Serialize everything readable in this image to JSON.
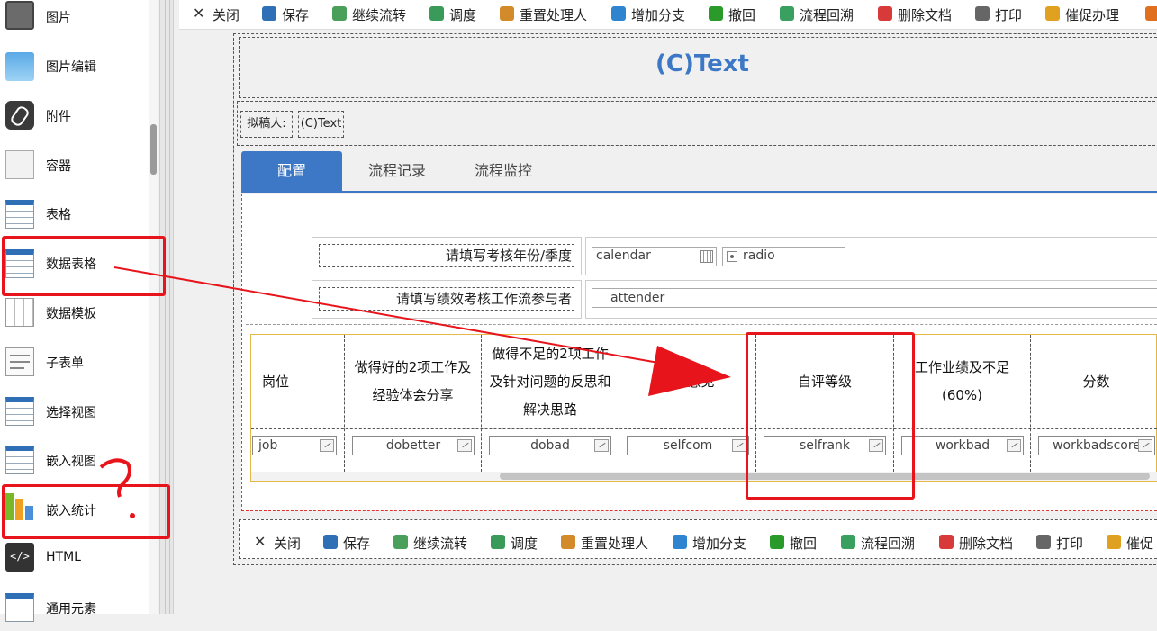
{
  "sidebar": {
    "items": [
      {
        "label": "图片",
        "icon": "image-icon"
      },
      {
        "label": "图片编辑",
        "icon": "image-edit-icon"
      },
      {
        "label": "附件",
        "icon": "attachment-icon"
      },
      {
        "label": "容器",
        "icon": "container-icon"
      },
      {
        "label": "表格",
        "icon": "table-icon"
      },
      {
        "label": "数据表格",
        "icon": "data-table-icon"
      },
      {
        "label": "数据模板",
        "icon": "data-template-icon"
      },
      {
        "label": "子表单",
        "icon": "subform-icon"
      },
      {
        "label": "选择视图",
        "icon": "select-view-icon"
      },
      {
        "label": "嵌入视图",
        "icon": "embed-view-icon"
      },
      {
        "label": "嵌入统计",
        "icon": "embed-chart-icon"
      },
      {
        "label": "HTML",
        "icon": "html-icon"
      },
      {
        "label": "通用元素",
        "icon": "generic-element-icon"
      }
    ]
  },
  "toolbar": {
    "buttons": [
      {
        "label": "关闭",
        "icon": "close-icon"
      },
      {
        "label": "保存",
        "icon": "save-icon"
      },
      {
        "label": "继续流转",
        "icon": "continue-flow-icon"
      },
      {
        "label": "调度",
        "icon": "dispatch-icon"
      },
      {
        "label": "重置处理人",
        "icon": "reset-handler-icon"
      },
      {
        "label": "增加分支",
        "icon": "add-branch-icon"
      },
      {
        "label": "撤回",
        "icon": "undo-icon"
      },
      {
        "label": "流程回溯",
        "icon": "flow-trace-icon"
      },
      {
        "label": "删除文档",
        "icon": "delete-doc-icon"
      },
      {
        "label": "打印",
        "icon": "print-icon"
      },
      {
        "label": "催促办理",
        "icon": "urge-icon"
      }
    ],
    "bottom_last_label": "催促"
  },
  "form": {
    "title": "(C)Text",
    "drafter_label": "拟稿人:",
    "drafter_value": "(C)Text",
    "tabs": [
      "配置",
      "流程记录",
      "流程监控"
    ],
    "row1_label": "请填写考核年份/季度",
    "calendar_value": "calendar",
    "radio_value": "radio",
    "row2_label": "请填写绩效考核工作流参与者",
    "attender_value": "attender",
    "headers": [
      "岗位",
      "做得好的2项工作及经验体会分享",
      "做得不足的2项工作及针对问题的反思和解决思路",
      "自评意见",
      "自评等级",
      "工作业绩及不足(60%)",
      "分数"
    ],
    "fields": [
      "job",
      "dobetter",
      "dobad",
      "selfcom",
      "selfrank",
      "workbad",
      "workbadscore"
    ]
  },
  "annotation": {
    "question_mark": "?"
  },
  "colors": {
    "accent_blue": "#3c78c6",
    "annotation_red": "#e8141b"
  }
}
